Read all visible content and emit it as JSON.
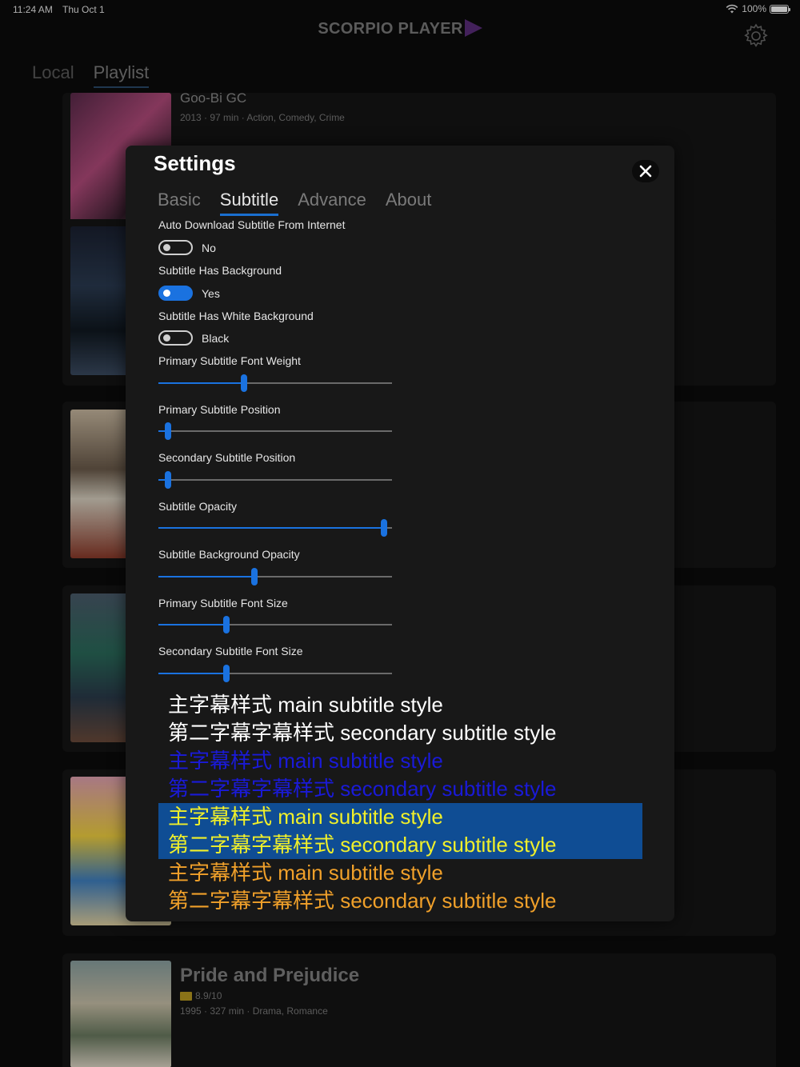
{
  "status_bar": {
    "time": "11:24 AM",
    "date": "Thu Oct 1",
    "battery": "100%"
  },
  "header": {
    "app_title": "SCORPIO PLAYER"
  },
  "top_tabs": [
    {
      "label": "Local"
    },
    {
      "label": "Playlist"
    }
  ],
  "movies": [
    {
      "title": "Goo-Bi GC",
      "meta": "2013 · 97 min · Action, Comedy, Crime"
    },
    {
      "title": "Pride and Prejudice",
      "rating": "8.9/10",
      "meta": "1995 · 327 min · Drama, Romance"
    }
  ],
  "settings": {
    "title": "Settings",
    "tabs": [
      {
        "label": "Basic"
      },
      {
        "label": "Subtitle"
      },
      {
        "label": "Advance"
      },
      {
        "label": "About"
      }
    ],
    "active_tab": "Subtitle",
    "toggles": [
      {
        "label": "Auto Download Subtitle From Internet",
        "state": "No",
        "on": false
      },
      {
        "label": "Subtitle Has Background",
        "state": "Yes",
        "on": true
      },
      {
        "label": "Subtitle Has White Background",
        "state": "Black",
        "on": false
      }
    ],
    "sliders": [
      {
        "label": "Primary Subtitle Font Weight",
        "value": 0.365
      },
      {
        "label": "Primary Subtitle Position",
        "value": 0.04
      },
      {
        "label": "Secondary Subtitle Position",
        "value": 0.04
      },
      {
        "label": "Subtitle Opacity",
        "value": 0.965
      },
      {
        "label": "Subtitle Background Opacity",
        "value": 0.41
      },
      {
        "label": "Primary Subtitle Font Size",
        "value": 0.29
      },
      {
        "label": "Secondary Subtitle Font Size",
        "value": 0.29
      }
    ],
    "preview": {
      "main": "主字幕样式 main subtitle style",
      "secondary": "第二字幕字幕样式 secondary subtitle style"
    }
  },
  "colors": {
    "accent": "#1a72e0",
    "preview_white": "#ffffff",
    "preview_blue": "#1a1ad8",
    "preview_highlight_bg": "#0f4d94",
    "preview_highlight_text": "#f0ef2a",
    "preview_orange": "#f0a02a"
  }
}
